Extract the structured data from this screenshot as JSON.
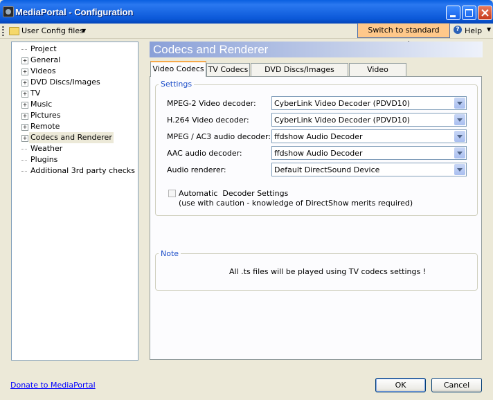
{
  "window": {
    "title": "MediaPortal - Configuration"
  },
  "toolbar": {
    "config_files_label": "User Config files",
    "switch_mode_label": "Switch to standard mode",
    "help_label": "Help"
  },
  "tree": {
    "items": [
      {
        "label": "Project",
        "expandable": false
      },
      {
        "label": "General",
        "expandable": true
      },
      {
        "label": "Videos",
        "expandable": true
      },
      {
        "label": "DVD Discs/Images",
        "expandable": true
      },
      {
        "label": "TV",
        "expandable": true
      },
      {
        "label": "Music",
        "expandable": true
      },
      {
        "label": "Pictures",
        "expandable": true
      },
      {
        "label": "Remote",
        "expandable": true
      },
      {
        "label": "Codecs and Renderer",
        "expandable": true,
        "selected": true
      },
      {
        "label": "Weather",
        "expandable": false
      },
      {
        "label": "Plugins",
        "expandable": false
      },
      {
        "label": "Additional 3rd party checks",
        "expandable": false
      }
    ]
  },
  "panel": {
    "title": "Codecs and Renderer",
    "tabs": [
      {
        "label": "Video Codecs",
        "active": true
      },
      {
        "label": "TV Codecs"
      },
      {
        "label": "DVD Discs/Images Codecs"
      },
      {
        "label": "Video Renderer"
      }
    ],
    "settings": {
      "title": "Settings",
      "rows": [
        {
          "label": "MPEG-2 Video decoder:",
          "value": "CyberLink Video Decoder (PDVD10)"
        },
        {
          "label": "H.264 Video decoder:",
          "value": "CyberLink Video Decoder (PDVD10)"
        },
        {
          "label": "MPEG / AC3 audio decoder:",
          "value": "ffdshow Audio Decoder"
        },
        {
          "label": "AAC audio decoder:",
          "value": "ffdshow Audio Decoder"
        },
        {
          "label": "Audio renderer:",
          "value": "Default DirectSound Device"
        }
      ],
      "auto_checkbox_label": "Automatic  Decoder Settings",
      "auto_checkbox_note": "(use with caution - knowledge of DirectShow merits required)",
      "auto_checked": false
    },
    "note": {
      "title": "Note",
      "text": "All .ts files will be played using TV codecs settings !"
    }
  },
  "footer": {
    "donate_link": "Donate to MediaPortal",
    "ok_label": "OK",
    "cancel_label": "Cancel"
  }
}
